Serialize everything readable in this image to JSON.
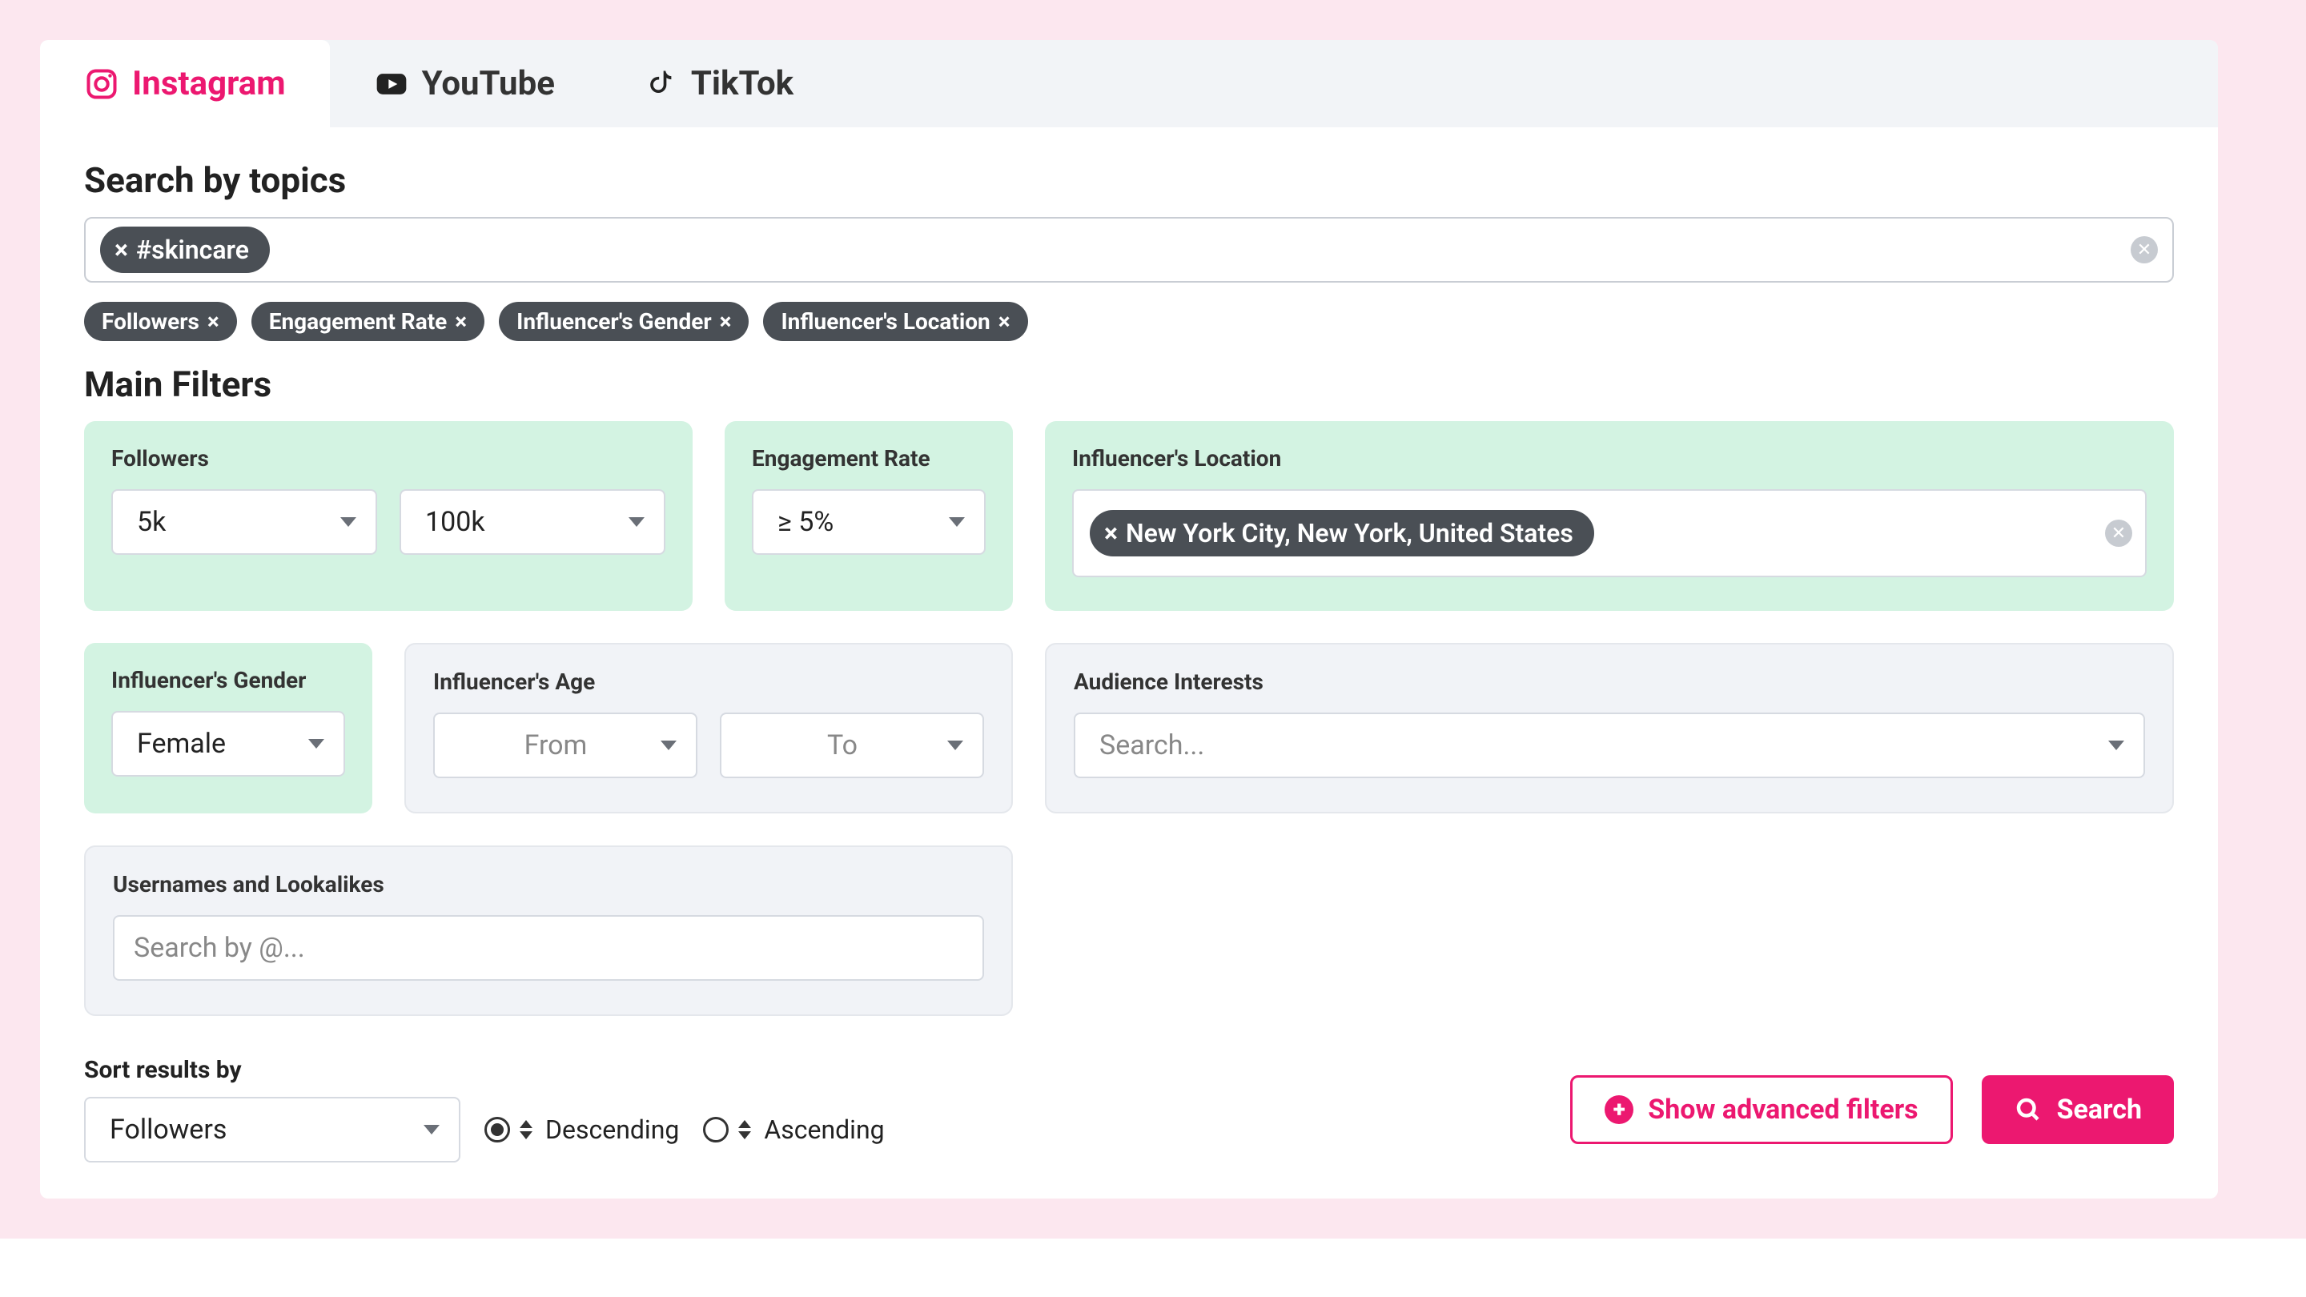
{
  "tabs": {
    "instagram": "Instagram",
    "youtube": "YouTube",
    "tiktok": "TikTok"
  },
  "search_section_title": "Search by topics",
  "topic_chip": "#skincare",
  "applied_filters": {
    "followers": "Followers",
    "engagement": "Engagement Rate",
    "gender": "Influencer's Gender",
    "location": "Influencer's Location"
  },
  "main_filters_title": "Main Filters",
  "filters": {
    "followers": {
      "label": "Followers",
      "from": "5k",
      "to": "100k"
    },
    "engagement": {
      "label": "Engagement Rate",
      "value": "≥ 5%"
    },
    "location": {
      "label": "Influencer's Location",
      "value": "New York City, New York, United States"
    },
    "gender": {
      "label": "Influencer's Gender",
      "value": "Female"
    },
    "age": {
      "label": "Influencer's Age",
      "from_placeholder": "From",
      "to_placeholder": "To"
    },
    "interests": {
      "label": "Audience Interests",
      "placeholder": "Search..."
    },
    "lookalikes": {
      "label": "Usernames and Lookalikes",
      "placeholder": "Search by @..."
    }
  },
  "sort": {
    "label": "Sort results by",
    "field": "Followers",
    "desc": "Descending",
    "asc": "Ascending"
  },
  "actions": {
    "advanced": "Show advanced filters",
    "search": "Search"
  },
  "remove_x": "×"
}
